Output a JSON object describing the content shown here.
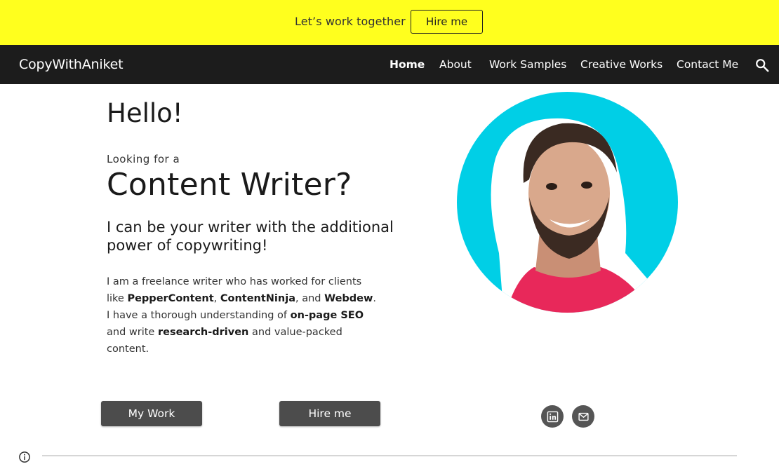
{
  "announcement": {
    "text": "Let’s work together",
    "button_label": "Hire me"
  },
  "navbar": {
    "brand": "CopyWithAniket",
    "items": [
      {
        "label": "Home",
        "active": true
      },
      {
        "label": "About",
        "active": false
      },
      {
        "label": "Work Samples",
        "active": false
      },
      {
        "label": "Creative Works",
        "active": false
      },
      {
        "label": "Contact Me",
        "active": false
      }
    ],
    "search_icon": "search-icon"
  },
  "hero": {
    "greeting": "Hello!",
    "lead_in": "Looking for a",
    "headline": "Content Writer?",
    "tagline": "I can be your writer with the additional power of copywriting!",
    "bio": {
      "p1": "I am a freelance writer who has worked for clients like ",
      "client1": "PepperContent",
      "sep1": ", ",
      "client2": "ContentNinja",
      "sep2": ", and ",
      "client3": "Webdew",
      "p2": ". I have a thorough understanding of ",
      "skill1": "on-page SEO",
      "p3": " and write ",
      "skill2": "research-driven",
      "p4": " and value-packed content."
    }
  },
  "actions": {
    "my_work_label": "My Work",
    "hire_me_label": "Hire me"
  },
  "social": {
    "icons": [
      "linkedin-icon",
      "email-icon"
    ]
  },
  "colors": {
    "announcement_bg": "#ffff1e",
    "navbar_bg": "#1c1c1c",
    "button_bg": "#4c4c4c",
    "portrait_bg": "#00cfe6"
  }
}
